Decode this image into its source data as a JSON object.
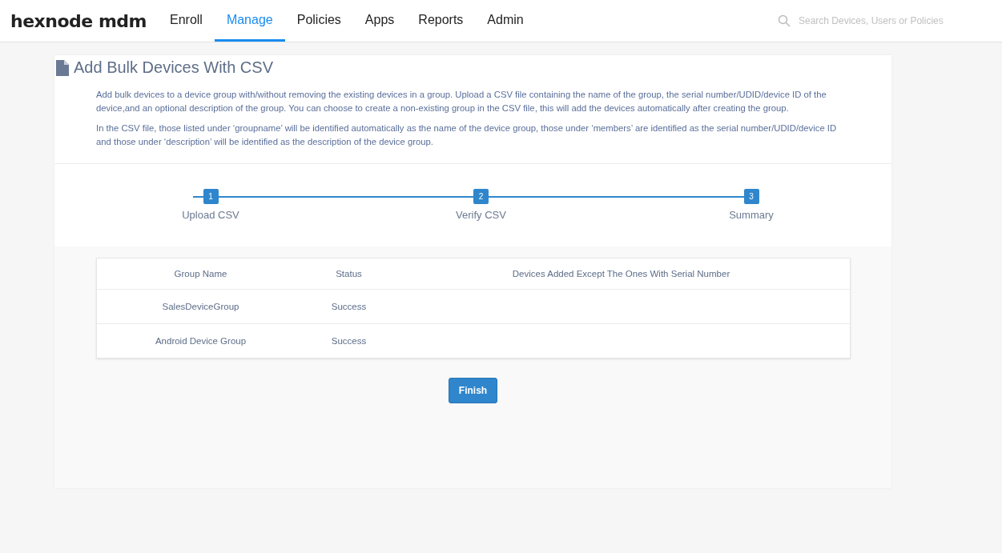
{
  "header": {
    "logo": "hexnode mdm",
    "nav": [
      {
        "label": "Enroll",
        "selected": false
      },
      {
        "label": "Manage",
        "selected": true
      },
      {
        "label": "Policies",
        "selected": false
      },
      {
        "label": "Apps",
        "selected": false
      },
      {
        "label": "Reports",
        "selected": false
      },
      {
        "label": "Admin",
        "selected": false
      }
    ],
    "search": {
      "placeholder": "Search Devices, Users or Policies"
    }
  },
  "page": {
    "title": "Add Bulk Devices With CSV",
    "paragraphs": [
      "Add bulk devices to a device group with/without removing the existing devices in a group. Upload a CSV file containing the name of the group, the serial number/UDID/device ID of the device,and an optional description of the group. You can choose to create a non-existing group in the CSV file, this will add the devices automatically after creating the group.",
      "In the CSV file, those listed under ‘groupname’ will be identified automatically as the name of the device group, those under ‘members’ are identified as the serial number/UDID/device ID and those under ‘description’ will be identified as the description of the device group."
    ]
  },
  "steps": [
    {
      "number": "1",
      "label": "Upload CSV"
    },
    {
      "number": "2",
      "label": "Verify CSV"
    },
    {
      "number": "3",
      "label": "Summary"
    }
  ],
  "table": {
    "columns": [
      "Group Name",
      "Status",
      "Devices Added Except The Ones With Serial Number"
    ],
    "rows": [
      [
        "SalesDeviceGroup",
        "Success"
      ],
      [
        "Android Device Group",
        "Success"
      ]
    ]
  },
  "finish_button": "Finish"
}
